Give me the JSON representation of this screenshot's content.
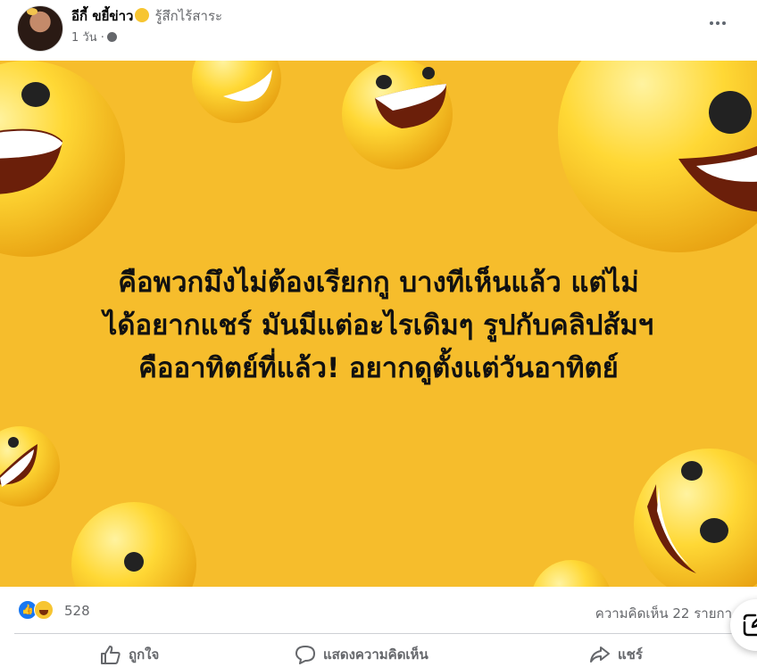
{
  "post": {
    "author_name": "อีกี้ ขยี้ข่าว",
    "feeling": "รู้สึกไร้สาระ",
    "time": "1 วัน ·",
    "image_text": "คือพวกมึงไม่ต้องเรียกกู บางทีเห็นแล้ว แต่ไม่\nได้อยากแชร์ มันมีแต่อะไรเดิมๆ รูปกับคลิปส้มฯ\nคืออาทิตย์ที่แล้ว! อยากดูตั้งแต่วันอาทิตย์",
    "image_background": "#f6bd2c"
  },
  "stats": {
    "reaction_count": "528",
    "comment_count": "ความคิดเห็น 22 รายกา"
  },
  "actions": {
    "like_label": "ถูกใจ",
    "comment_label": "แสดงความคิดเห็น",
    "share_label": "แชร์"
  },
  "icons": {
    "reactions": [
      "like-icon",
      "haha-icon"
    ],
    "audience": "globe-icon",
    "more": "more-dots-icon",
    "compose": "compose-icon"
  }
}
